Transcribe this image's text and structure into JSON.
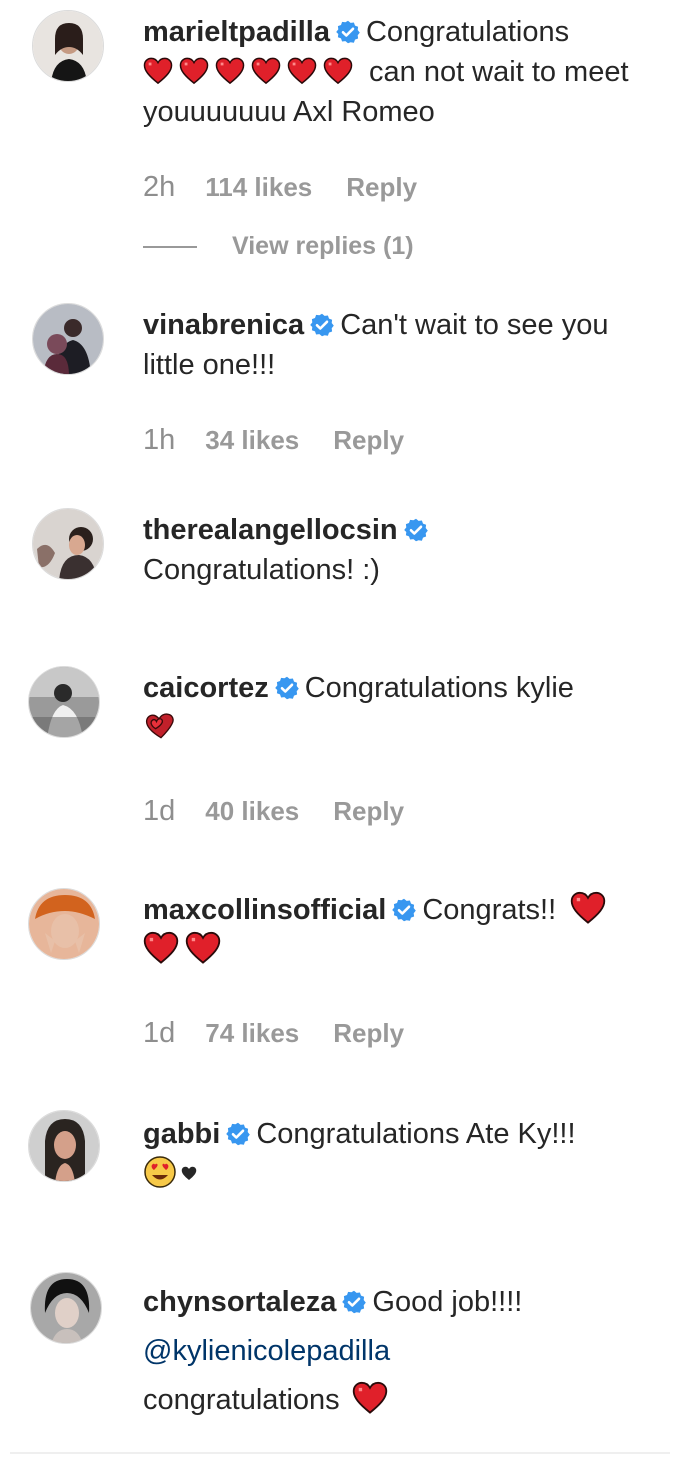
{
  "comments": [
    {
      "username": "marieltpadilla",
      "text_before": "Congratulations",
      "text_after": "can not wait to meet youuuuuuu Axl Romeo",
      "time": "2h",
      "likes": "114 likes",
      "reply": "Reply",
      "view_replies": "View replies (1)"
    },
    {
      "username": "vinabrenica",
      "text": "Can't wait to see you little one!!!",
      "time": "1h",
      "likes": "34 likes",
      "reply": "Reply"
    },
    {
      "username": "therealangellocsin",
      "text": "Congratulations! :)"
    },
    {
      "username": "caicortez",
      "text": "Congratulations kylie",
      "time": "1d",
      "likes": "40 likes",
      "reply": "Reply"
    },
    {
      "username": "maxcollinsofficial",
      "text": "Congrats!!",
      "time": "1d",
      "likes": "74 likes",
      "reply": "Reply"
    },
    {
      "username": "gabbi",
      "text": "Congratulations Ate Ky!!!"
    },
    {
      "username": "chynsortaleza",
      "text": "Good job!!!!",
      "mention": "@kylienicolepadilla",
      "text_end": "congratulations"
    }
  ],
  "colors": {
    "verified": "#3897f0",
    "heart": "#e0202a",
    "meta": "#999999",
    "mention": "#003569"
  },
  "icons": [
    "verified-badge-icon",
    "red-heart-icon",
    "two-hearts-icon",
    "heart-eyes-emoji-icon",
    "black-heart-icon"
  ]
}
